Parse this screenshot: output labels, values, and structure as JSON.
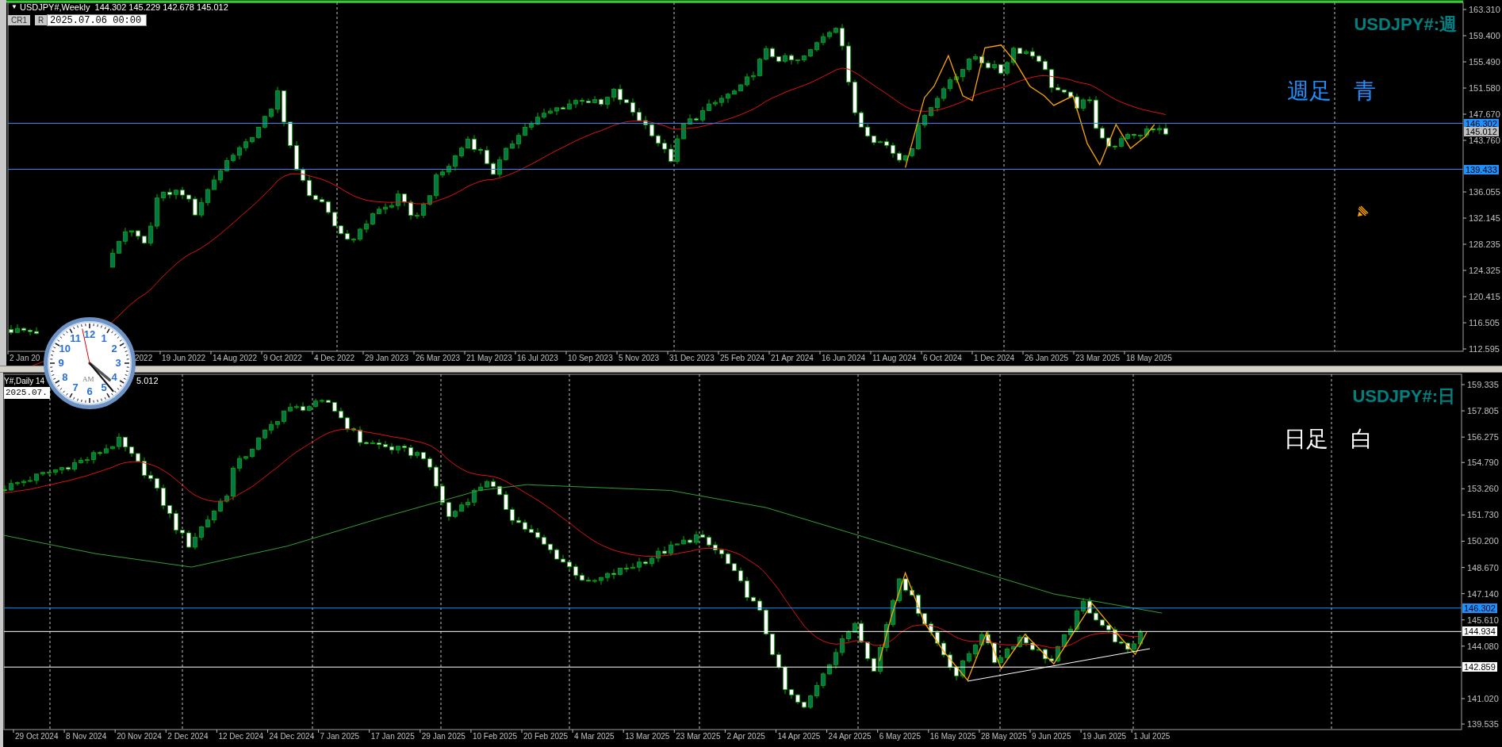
{
  "weekly_chart": {
    "menu_glyph": "▼",
    "header": "USDJPY#,Weekly  144.302 145.229 142.678 145.012",
    "buttons": [
      "CR1",
      "R"
    ],
    "date_field": "2025.07.06 00:00",
    "symbol_label": "USDJPY#:週",
    "note": "週足　青",
    "price_axis": [
      "163.310",
      "159.400",
      "155.490",
      "151.580",
      "147.670",
      "143.760",
      "136.055",
      "132.145",
      "128.235",
      "124.325",
      "120.415",
      "116.505",
      "112.595"
    ],
    "price_tags": [
      {
        "text": "146.302",
        "kind": "line"
      },
      {
        "text": "145.012",
        "kind": "bid"
      },
      {
        "text": "139.433",
        "kind": "line"
      }
    ],
    "time_axis": [
      "2 Jan 20",
      "2022",
      "19 Jun 2022",
      "14 Aug 2022",
      "9 Oct 2022",
      "4 Dec 2022",
      "29 Jan 2023",
      "26 Mar 2023",
      "21 May 2023",
      "16 Jul 2023",
      "10 Sep 2023",
      "5 Nov 2023",
      "31 Dec 2023",
      "25 Feb 2024",
      "21 Apr 2024",
      "16 Jun 2024",
      "11 Aug 2024",
      "6 Oct 2024",
      "1 Dec 2024",
      "26 Jan 2025",
      "23 Mar 2025",
      "18 May 2025"
    ]
  },
  "daily_chart": {
    "header_parts": [
      "Y#,Daily 14",
      "5.012"
    ],
    "date_field": "2025.07.",
    "symbol_label": "USDJPY#:日",
    "note": "日足　白",
    "price_axis": [
      "159.335",
      "157.805",
      "156.275",
      "154.790",
      "153.260",
      "151.730",
      "150.200",
      "148.670",
      "147.140",
      "145.610",
      "144.080",
      "141.020",
      "139.535"
    ],
    "price_tags": [
      {
        "text": "146.302",
        "kind": "line"
      },
      {
        "text": "144.934",
        "kind": "level"
      },
      {
        "text": "142.859",
        "kind": "level"
      }
    ],
    "time_axis": [
      "29 Oct 2024",
      "8 Nov 2024",
      "20 Nov 2024",
      "2 Dec 2024",
      "12 Dec 2024",
      "24 Dec 2024",
      "7 Jan 2025",
      "17 Jan 2025",
      "29 Jan 2025",
      "10 Feb 2025",
      "20 Feb 2025",
      "4 Mar 2025",
      "13 Mar 2025",
      "23 Mar 2025",
      "2 Apr 2025",
      "14 Apr 2025",
      "24 Apr 2025",
      "6 May 2025",
      "16 May 2025",
      "28 May 2025",
      "9 Jun 2025",
      "19 Jun 2025",
      "1 Jul 2025"
    ]
  },
  "clock": {
    "numerals": [
      "12",
      "11",
      "1",
      "10",
      "2",
      "9",
      "3",
      "8",
      "4",
      "7",
      "5",
      "6"
    ],
    "period": "AM"
  }
}
